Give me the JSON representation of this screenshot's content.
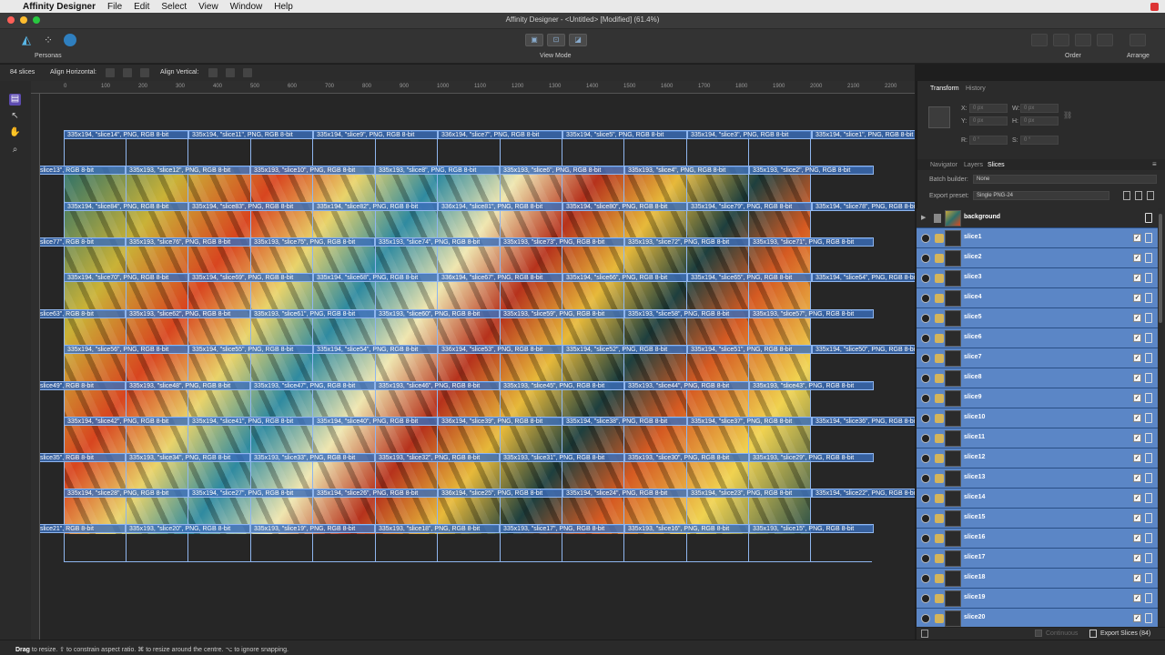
{
  "menubar": {
    "app_name": "Affinity Designer",
    "items": [
      "File",
      "Edit",
      "Select",
      "View",
      "Window",
      "Help"
    ]
  },
  "window_title": "Affinity Designer - <Untitled> [Modified] (61.4%)",
  "toolbar": {
    "personas_label": "Personas",
    "view_mode_label": "View Mode",
    "order_label": "Order",
    "arrange_label": "Arrange"
  },
  "context_toolbar": {
    "slice_count": "84 slices",
    "align_horizontal": "Align Horizontal:",
    "align_vertical": "Align Vertical:"
  },
  "ruler_ticks": [
    "0",
    "100",
    "200",
    "300",
    "400",
    "500",
    "600",
    "700",
    "800",
    "900",
    "1000",
    "1100",
    "1200",
    "1300",
    "1400",
    "1500",
    "1600",
    "1700",
    "1800",
    "1900",
    "2000",
    "2100",
    "2200"
  ],
  "slice_labels": [
    [
      "335x194, \"slice14\", PNG, RGB 8-bit",
      "335x194, \"slice11\", PNG, RGB 8-bit",
      "335x194, \"slice9\", PNG, RGB 8-bit",
      "336x194, \"slice7\", PNG, RGB 8-bit",
      "335x194, \"slice5\", PNG, RGB 8-bit",
      "335x194, \"slice3\", PNG, RGB 8-bit",
      "335x194, \"slice1\", PNG, RGB 8-bit"
    ],
    [
      "slice13\", RGB 8-bit",
      "335x193, \"slice12\", PNG, RGB 8-bit",
      "335x193, \"slice10\", PNG, RGB 8-bit",
      "335x193, \"slice8\", PNG, RGB 8-bit",
      "335x193, \"slice6\", PNG, RGB 8-bit",
      "335x193, \"slice4\", PNG, RGB 8-bit",
      "335x193, \"slice2\", PNG, RGB 8-bit"
    ],
    [
      "335x194, \"slice84\", PNG, RGB 8-bit",
      "335x194, \"slice83\", PNG, RGB 8-bit",
      "335x194, \"slice82\", PNG, RGB 8-bit",
      "336x194, \"slice81\", PNG, RGB 8-bit",
      "335x194, \"slice80\", PNG, RGB 8-bit",
      "335x194, \"slice79\", PNG, RGB 8-bit",
      "335x194, \"slice78\", PNG, RGB 8-bit"
    ],
    [
      "slice77\", RGB 8-bit",
      "335x193, \"slice76\", PNG, RGB 8-bit",
      "335x193, \"slice75\", PNG, RGB 8-bit",
      "335x193, \"slice74\", PNG, RGB 8-bit",
      "335x193, \"slice73\", PNG, RGB 8-bit",
      "335x193, \"slice72\", PNG, RGB 8-bit",
      "335x193, \"slice71\", PNG, RGB 8-bit"
    ],
    [
      "335x194, \"slice70\", PNG, RGB 8-bit",
      "335x194, \"slice69\", PNG, RGB 8-bit",
      "335x194, \"slice68\", PNG, RGB 8-bit",
      "336x194, \"slice67\", PNG, RGB 8-bit",
      "335x194, \"slice66\", PNG, RGB 8-bit",
      "335x194, \"slice65\", PNG, RGB 8-bit",
      "335x194, \"slice64\", PNG, RGB 8-bit"
    ],
    [
      "slice63\", RGB 8-bit",
      "335x193, \"slice62\", PNG, RGB 8-bit",
      "335x193, \"slice61\", PNG, RGB 8-bit",
      "335x193, \"slice60\", PNG, RGB 8-bit",
      "335x193, \"slice59\", PNG, RGB 8-bit",
      "335x193, \"slice58\", PNG, RGB 8-bit",
      "335x193, \"slice57\", PNG, RGB 8-bit"
    ],
    [
      "335x194, \"slice56\", PNG, RGB 8-bit",
      "335x194, \"slice55\", PNG, RGB 8-bit",
      "335x194, \"slice54\", PNG, RGB 8-bit",
      "336x194, \"slice53\", PNG, RGB 8-bit",
      "335x194, \"slice52\", PNG, RGB 8-bit",
      "335x194, \"slice51\", PNG, RGB 8-bit",
      "335x194, \"slice50\", PNG, RGB 8-bit"
    ],
    [
      "slice49\", RGB 8-bit",
      "335x193, \"slice48\", PNG, RGB 8-bit",
      "335x193, \"slice47\", PNG, RGB 8-bit",
      "335x193, \"slice46\", PNG, RGB 8-bit",
      "335x193, \"slice45\", PNG, RGB 8-bit",
      "335x193, \"slice44\", PNG, RGB 8-bit",
      "335x193, \"slice43\", PNG, RGB 8-bit"
    ],
    [
      "335x194, \"slice42\", PNG, RGB 8-bit",
      "335x194, \"slice41\", PNG, RGB 8-bit",
      "335x194, \"slice40\", PNG, RGB 8-bit",
      "336x194, \"slice39\", PNG, RGB 8-bit",
      "335x194, \"slice38\", PNG, RGB 8-bit",
      "335x194, \"slice37\", PNG, RGB 8-bit",
      "335x194, \"slice36\", PNG, RGB 8-bit"
    ],
    [
      "slice35\", RGB 8-bit",
      "335x193, \"slice34\", PNG, RGB 8-bit",
      "335x193, \"slice33\", PNG, RGB 8-bit",
      "335x193, \"slice32\", PNG, RGB 8-bit",
      "335x193, \"slice31\", PNG, RGB 8-bit",
      "335x193, \"slice30\", PNG, RGB 8-bit",
      "335x193, \"slice29\", PNG, RGB 8-bit"
    ],
    [
      "335x194, \"slice28\", PNG, RGB 8-bit",
      "335x194, \"slice27\", PNG, RGB 8-bit",
      "335x194, \"slice26\", PNG, RGB 8-bit",
      "336x194, \"slice25\", PNG, RGB 8-bit",
      "335x194, \"slice24\", PNG, RGB 8-bit",
      "335x194, \"slice23\", PNG, RGB 8-bit",
      "335x194, \"slice22\", PNG, RGB 8-bit"
    ],
    [
      "slice21\", RGB 8-bit",
      "335x193, \"slice20\", PNG, RGB 8-bit",
      "335x193, \"slice19\", PNG, RGB 8-bit",
      "335x193, \"slice18\", PNG, RGB 8-bit",
      "335x193, \"slice17\", PNG, RGB 8-bit",
      "335x193, \"slice16\", PNG, RGB 8-bit",
      "335x193, \"slice15\", PNG, RGB 8-bit"
    ]
  ],
  "right_panel": {
    "tabs_top": [
      "Transform",
      "History"
    ],
    "transform": {
      "x_label": "X:",
      "x_value": "0 px",
      "y_label": "Y:",
      "y_value": "0 px",
      "w_label": "W:",
      "w_value": "0 px",
      "h_label": "H:",
      "h_value": "0 px",
      "r_label": "R:",
      "r_value": "0 °",
      "s_label": "S:",
      "s_value": "0 °"
    },
    "tabs_mid": [
      "Navigator",
      "Layers",
      "Slices"
    ],
    "batch_builder_label": "Batch builder:",
    "batch_builder_value": "None",
    "export_preset_label": "Export preset:",
    "export_preset_value": "Single PNG-24",
    "background_layer": "background",
    "slices": [
      "slice1",
      "slice2",
      "slice3",
      "slice4",
      "slice5",
      "slice6",
      "slice7",
      "slice8",
      "slice9",
      "slice10",
      "slice11",
      "slice12",
      "slice13",
      "slice14",
      "slice15",
      "slice16",
      "slice17",
      "slice18",
      "slice19",
      "slice20"
    ],
    "continuous_label": "Continuous",
    "export_button": "Export Slices (84)"
  },
  "status_bar": {
    "drag": "Drag",
    "text": " to resize. ⇧ to constrain aspect ratio. ⌘ to resize around the centre. ⌥ to ignore snapping."
  },
  "colors": {
    "selection_blue": "#5b86c6",
    "slice_label_bg": "#3a6eb9",
    "guide_blue": "#8fb6ef"
  }
}
